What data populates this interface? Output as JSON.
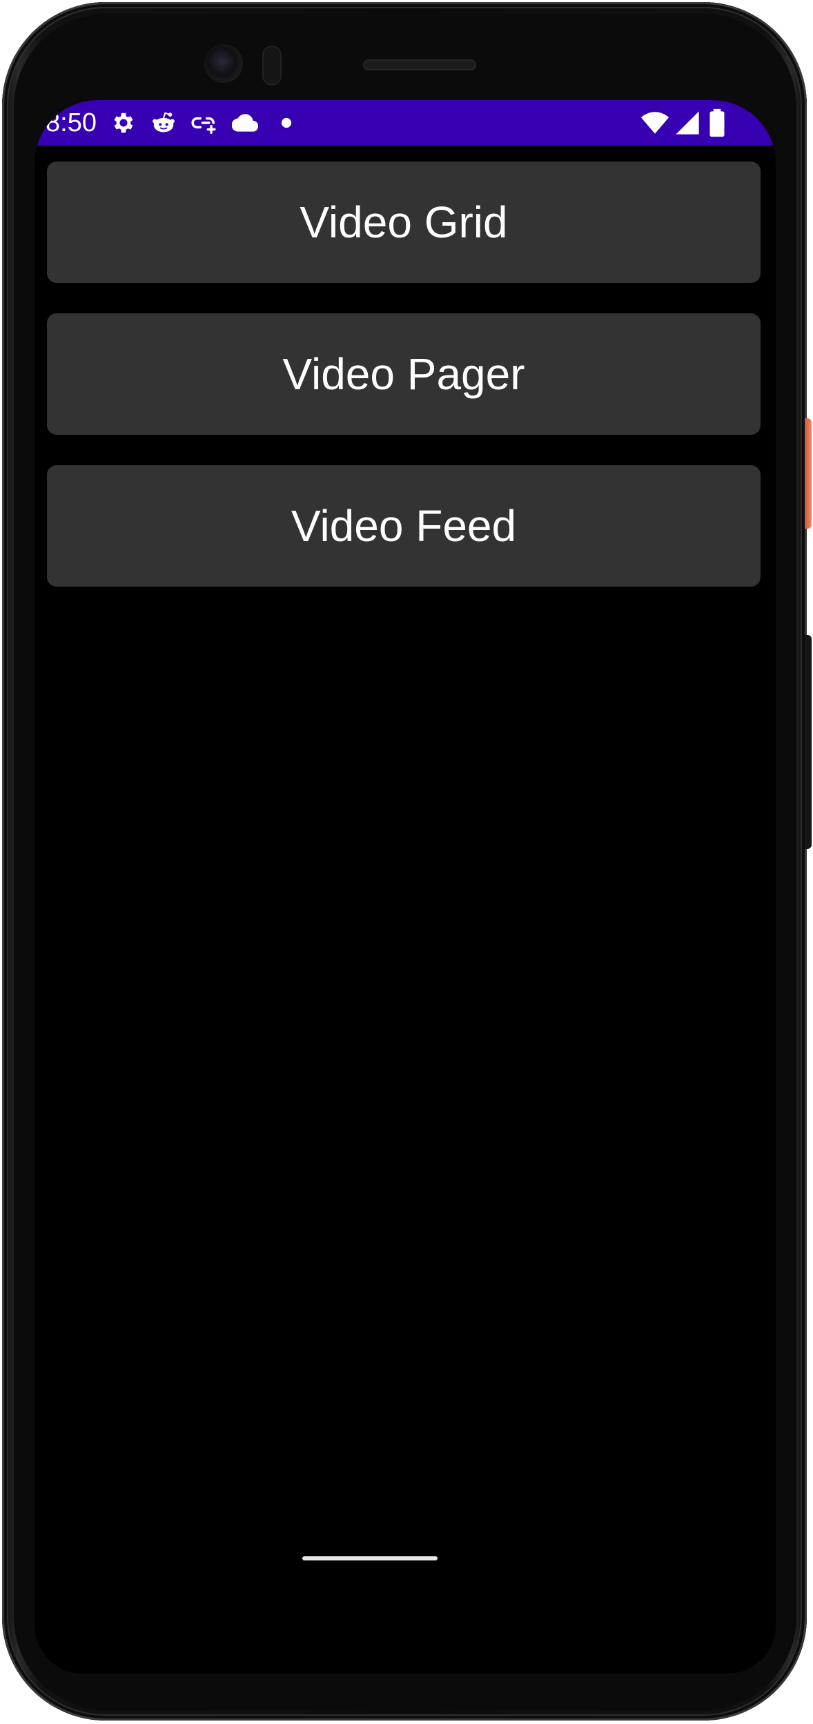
{
  "status_bar": {
    "time": "8:50",
    "left_icons": [
      "gear-icon",
      "reddit-icon",
      "link-add-icon",
      "cloud-icon",
      "dot-icon"
    ],
    "right_icons": [
      "wifi-icon",
      "signal-icon",
      "battery-icon"
    ],
    "background_color": "#3700b3"
  },
  "menu": {
    "buttons": [
      {
        "label": "Video Grid"
      },
      {
        "label": "Video Pager"
      },
      {
        "label": "Video Feed"
      }
    ],
    "button_color": "#333333",
    "background_color": "#000000"
  }
}
